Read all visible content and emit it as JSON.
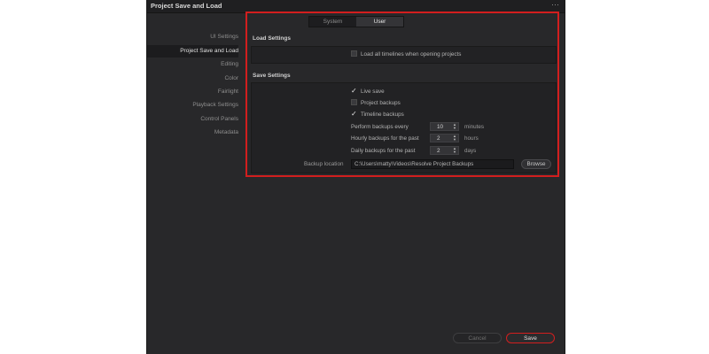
{
  "window": {
    "title": "Project Save and Load",
    "menu_icon": "more-dots-icon",
    "menu_glyph": "···"
  },
  "sidebar": {
    "items": [
      {
        "label": "UI Settings",
        "active": false
      },
      {
        "label": "Project Save and Load",
        "active": true
      },
      {
        "label": "Editing",
        "active": false
      },
      {
        "label": "Color",
        "active": false
      },
      {
        "label": "Fairlight",
        "active": false
      },
      {
        "label": "Playback Settings",
        "active": false
      },
      {
        "label": "Control Panels",
        "active": false
      },
      {
        "label": "Metadata",
        "active": false
      }
    ]
  },
  "tabs": [
    {
      "label": "System",
      "active": false
    },
    {
      "label": "User",
      "active": true
    }
  ],
  "load_settings": {
    "heading": "Load Settings",
    "load_all_timelines": {
      "label": "Load all timelines when opening projects",
      "checked": false
    }
  },
  "save_settings": {
    "heading": "Save Settings",
    "live_save": {
      "label": "Live save",
      "checked": true
    },
    "project_backups": {
      "label": "Project backups",
      "checked": false
    },
    "timeline_backups": {
      "label": "Timeline backups",
      "checked": true
    },
    "perform_backups": {
      "label": "Perform backups every",
      "value": "10",
      "unit": "minutes"
    },
    "hourly_backups": {
      "label": "Hourly backups for the past",
      "value": "2",
      "unit": "hours"
    },
    "daily_backups": {
      "label": "Daily backups for the past",
      "value": "2",
      "unit": "days"
    },
    "backup_location": {
      "label": "Backup location",
      "value": "C:\\Users\\matty\\Videos\\Resolve Project Backups",
      "browse_label": "Browse"
    }
  },
  "footer": {
    "cancel_label": "Cancel",
    "save_label": "Save"
  },
  "glyphs": {
    "check": "✓",
    "spin_up": "▲",
    "spin_down": "▼"
  },
  "colors": {
    "highlight": "#d21e1e",
    "background": "#28282a",
    "save_border": "#d21e1e"
  }
}
